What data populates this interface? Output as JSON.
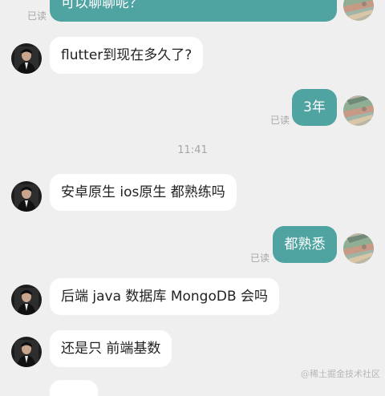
{
  "messages": [
    {
      "side": "out",
      "text": "可以聊聊呢？",
      "status": "已读"
    },
    {
      "side": "in",
      "text": "flutter到现在多久了?"
    },
    {
      "side": "out",
      "text": "3年",
      "status": "已读"
    },
    {
      "side": "in",
      "text": "安卓原生 ios原生 都熟练吗"
    },
    {
      "side": "out",
      "text": "都熟悉",
      "status": "已读"
    },
    {
      "side": "in",
      "text": "后端 java  数据库 MongoDB 会吗"
    },
    {
      "side": "in",
      "text": "还是只 前端基数"
    }
  ],
  "timestamp": "11:41",
  "watermark": "@稀土掘金技术社区",
  "colors": {
    "outgoing_bubble": "#4fa3a1",
    "incoming_bubble": "#ffffff",
    "background": "#efefef"
  },
  "icons": {
    "contact_avatar": "person-in-dark-suit",
    "my_avatar": "banknotes-photo"
  }
}
